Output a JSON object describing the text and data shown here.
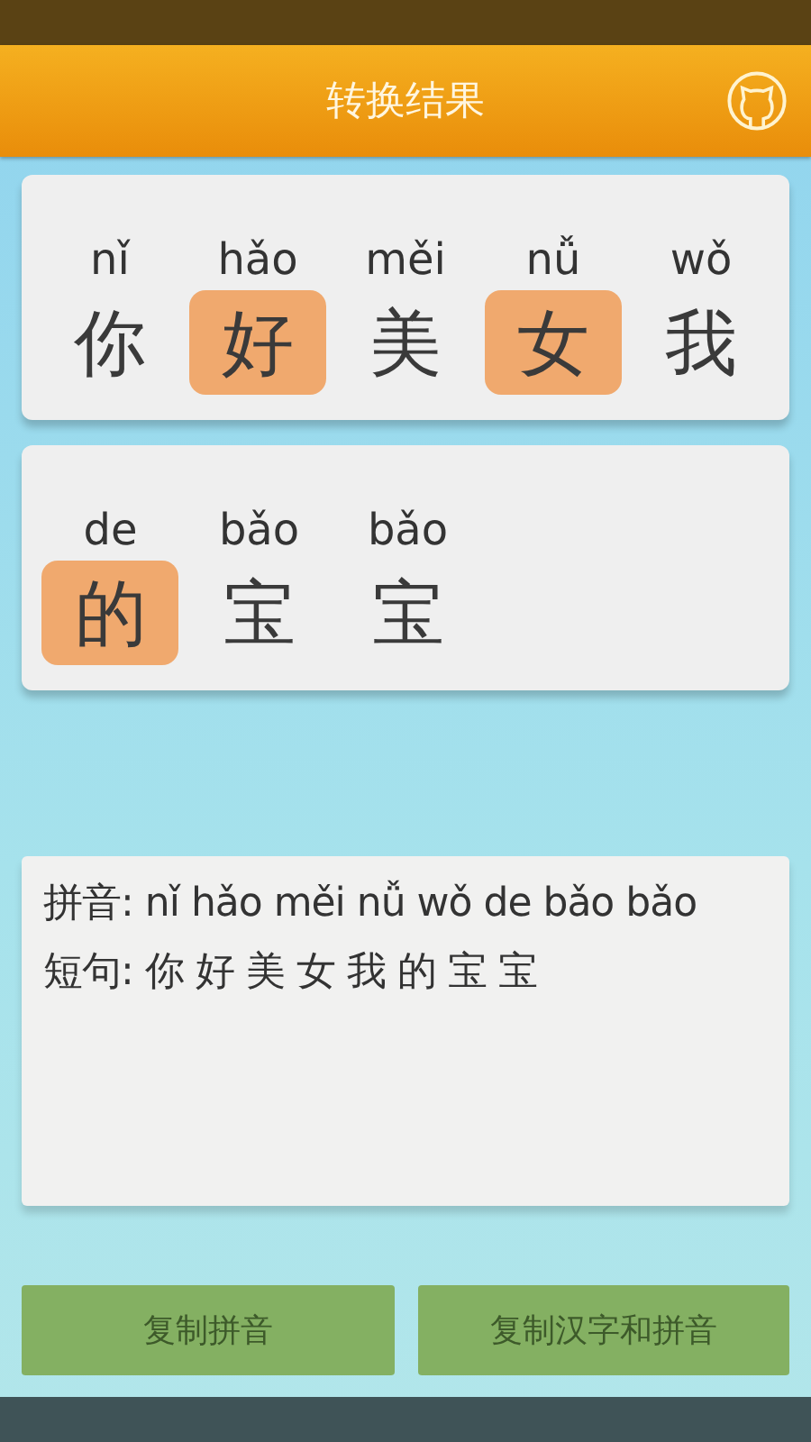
{
  "header": {
    "title": "转换结果"
  },
  "cards": [
    {
      "cells": [
        {
          "pinyin": "nǐ",
          "hanzi": "你",
          "highlighted": false
        },
        {
          "pinyin": "hǎo",
          "hanzi": "好",
          "highlighted": true
        },
        {
          "pinyin": "měi",
          "hanzi": "美",
          "highlighted": false
        },
        {
          "pinyin": "nǚ",
          "hanzi": "女",
          "highlighted": true
        },
        {
          "pinyin": "wǒ",
          "hanzi": "我",
          "highlighted": false
        }
      ]
    },
    {
      "cells": [
        {
          "pinyin": "de",
          "hanzi": "的",
          "highlighted": true
        },
        {
          "pinyin": "bǎo",
          "hanzi": "宝",
          "highlighted": false
        },
        {
          "pinyin": "bǎo",
          "hanzi": "宝",
          "highlighted": false
        }
      ]
    }
  ],
  "result": {
    "lines": [
      "拼音: nǐ hǎo měi nǚ wǒ de bǎo bǎo",
      "短句: 你 好 美 女 我 的 宝 宝"
    ]
  },
  "buttons": [
    "复制拼音",
    "复制汉字和拼音"
  ]
}
